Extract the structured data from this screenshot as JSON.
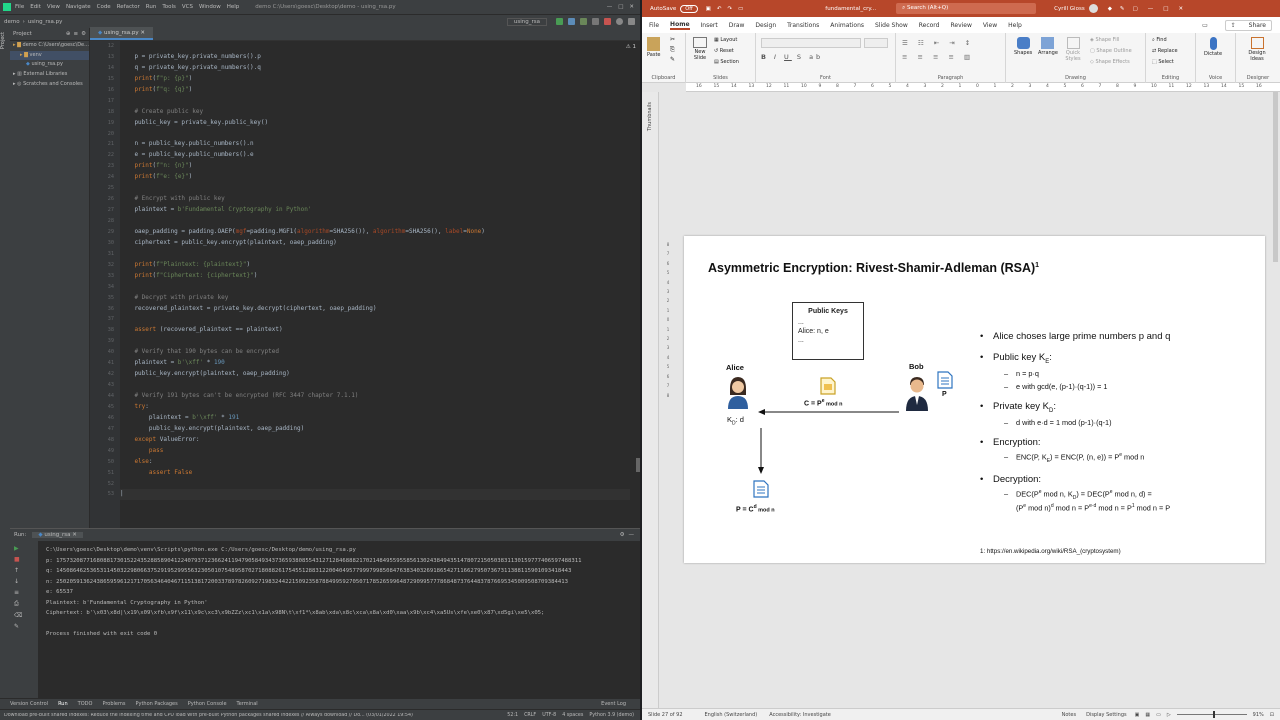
{
  "ide": {
    "menu": [
      "File",
      "Edit",
      "View",
      "Navigate",
      "Code",
      "Refactor",
      "Run",
      "Tools",
      "VCS",
      "Window",
      "Help"
    ],
    "window_title": "demo C:\\Users\\goesc\\Desktop\\demo - using_rsa.py",
    "breadcrumb": [
      "demo",
      "using_rsa.py"
    ],
    "run_config": "using_rsa",
    "project_header": "Project",
    "project_tree": [
      "demo C:\\Users\\goesc\\De...",
      "venv",
      "using_rsa.py",
      "External Libraries",
      "Scratches and Consoles"
    ],
    "editor_tab": "using_rsa.py",
    "warning_badge": "⚠ 1",
    "line_numbers": [
      "12",
      "13",
      "14",
      "15",
      "16",
      "17",
      "18",
      "19",
      "20",
      "21",
      "22",
      "23",
      "24",
      "25",
      "26",
      "27",
      "28",
      "29",
      "30",
      "31",
      "32",
      "33",
      "34",
      "35",
      "36",
      "37",
      "38",
      "39",
      "40",
      "41",
      "42",
      "43",
      "44",
      "45",
      "46",
      "47",
      "48",
      "49",
      "50",
      "51",
      "52",
      "53"
    ],
    "run_panel": {
      "tab_label": "Run:",
      "tab_name": "using_rsa",
      "output": [
        "C:\\Users\\goesc\\Desktop\\demo\\venv\\Scripts\\python.exe C:/Users/goesc/Desktop/demo/using_rsa.py",
        "p: 175732087716808817301522435288589041224079371236624119479058493437365938085543127128468882170214849559558561302438494351478072150503831130159777406597488311",
        "q: 145086462536531145032298066375291952995563230501075489587027180882617545512883122004049577999799850847638340326918654271166279507367311388115901093418443",
        "n: 25020591362438659596121717056346404671151381720033789782609271983244221509235878849959270507178526599648729099577786848737644837876695345009508709384413",
        "e: 65537",
        "Plaintext: b'Fundamental Cryptography in Python'",
        "Ciphertext: b'\\x03\\x8d|\\x19\\x09\\xfb\\x9f\\x11\\x9c\\xc3\\x9bZZz\\xc1\\x1a\\x98N\\t\\xf1*\\x8ab\\xda\\x8c\\xca\\x8a\\xd0\\xaa\\x9b\\xc4\\xa5Us\\xfe\\xe0\\x87\\xd5gi\\xe5\\x05;",
        "",
        "Process finished with exit code 0"
      ]
    },
    "bottom_tabs": [
      "Version Control",
      "Run",
      "TODO",
      "Problems",
      "Python Packages",
      "Python Console",
      "Terminal",
      "Event Log"
    ],
    "status": {
      "message": "Download pre-built shared indexes: Reduce the indexing time and CPU load with pre-built Python packages shared indexes // Always download // Do... (03/01/2022 19:54)",
      "position": "52:1",
      "line_sep": "CRLF",
      "encoding": "UTF-8",
      "indent": "4 spaces",
      "interpreter": "Python 3.9 (demo)"
    }
  },
  "ppt": {
    "autosave_label": "AutoSave",
    "autosave_state": "Off",
    "file_title": "fundamental_cry...",
    "search_placeholder": "Search (Alt+Q)",
    "user": "Cyrill Gioss",
    "share_label": "Share",
    "tabs": [
      "File",
      "Home",
      "Insert",
      "Draw",
      "Design",
      "Transitions",
      "Animations",
      "Slide Show",
      "Record",
      "Review",
      "View",
      "Help"
    ],
    "active_tab": "Home",
    "ribbon": {
      "clipboard": {
        "label": "Clipboard",
        "paste": "Paste"
      },
      "slides": {
        "label": "Slides",
        "new_slide": "New Slide",
        "layout": "Layout",
        "reset": "Reset",
        "section": "Section"
      },
      "font": {
        "label": "Font"
      },
      "paragraph": {
        "label": "Paragraph"
      },
      "drawing": {
        "label": "Drawing",
        "shapes": "Shapes",
        "arrange": "Arrange",
        "quick_styles": "Quick Styles",
        "shape_fill": "Shape Fill",
        "shape_outline": "Shape Outline",
        "shape_effects": "Shape Effects"
      },
      "editing": {
        "label": "Editing",
        "find": "Find",
        "replace": "Replace",
        "select": "Select"
      },
      "voice": {
        "label": "Voice",
        "dictate": "Dictate"
      },
      "designer": {
        "label": "Designer",
        "design_ideas": "Design Ideas"
      }
    },
    "thumbnails_label": "Thumbnails",
    "ruler_ticks": [
      "16",
      "15",
      "14",
      "13",
      "12",
      "11",
      "10",
      "9",
      "8",
      "7",
      "6",
      "5",
      "4",
      "3",
      "2",
      "1",
      "0",
      "1",
      "2",
      "3",
      "4",
      "5",
      "6",
      "7",
      "8",
      "9",
      "10",
      "11",
      "12",
      "13",
      "14",
      "15",
      "16"
    ],
    "slide": {
      "title": "Asymmetric Encryption: Rivest-Shamir-Adleman (RSA)",
      "title_sup": "1",
      "public_keys_box": {
        "title": "Public Keys",
        "lines": [
          "...",
          "Alice: n, e",
          "..."
        ]
      },
      "alice": "Alice",
      "bob": "Bob",
      "alice_key": "K",
      "alice_key_sub": "D",
      "alice_key_suffix": ": d",
      "cipher_label": "C = P",
      "cipher_sup": "e",
      "cipher_mod": " mod n",
      "bob_doc": "P",
      "plain_label": "P = C",
      "plain_sup": "d",
      "plain_mod": " mod n",
      "bullets": [
        {
          "text": "Alice choses large prime numbers p and q"
        },
        {
          "text": "Public key K",
          "sub": "E",
          "suffix": ":"
        },
        {
          "text": "Private key K",
          "sub": "D",
          "suffix": ":"
        },
        {
          "text": "Encryption:"
        },
        {
          "text": "Decryption:"
        }
      ],
      "pub_sub1": "n = p·q",
      "pub_sub2": "e with gcd(e, (p-1)·(q-1)) = 1",
      "priv_sub1": "d with e·d = 1 mod (p-1)·(q-1)",
      "enc_sub": "ENC(P, K",
      "enc_sub_E": "E",
      "enc_sub_rest": ") = ENC(P, (n, e)) = P",
      "enc_sup": "e",
      "enc_mod": " mod n",
      "dec_line1": "DEC(P",
      "dec_line1_sup": "e",
      "dec_line1_rest": " mod n, K",
      "dec_line1_sub": "D",
      "dec_line1_rest2": ") = DEC(P",
      "dec_line1_sup2": "e",
      "dec_line1_end": " mod n, d) =",
      "dec_line2": "(P",
      "dec_line2_sup": "e",
      "dec_line2_a": " mod n)",
      "dec_line2_supd": "d",
      "dec_line2_b": " mod n = P",
      "dec_line2_suped": "e·d",
      "dec_line2_c": " mod n = P",
      "dec_line2_sup1": "1",
      "dec_line2_d": " mod n = P",
      "reference": "1: https://en.wikipedia.org/wiki/RSA_(cryptosystem)"
    },
    "status": {
      "slide_of": "Slide 27 of 92",
      "language": "English (Switzerland)",
      "accessibility": "Accessibility: Investigate",
      "notes": "Notes",
      "display": "Display Settings",
      "zoom": "91%"
    }
  }
}
